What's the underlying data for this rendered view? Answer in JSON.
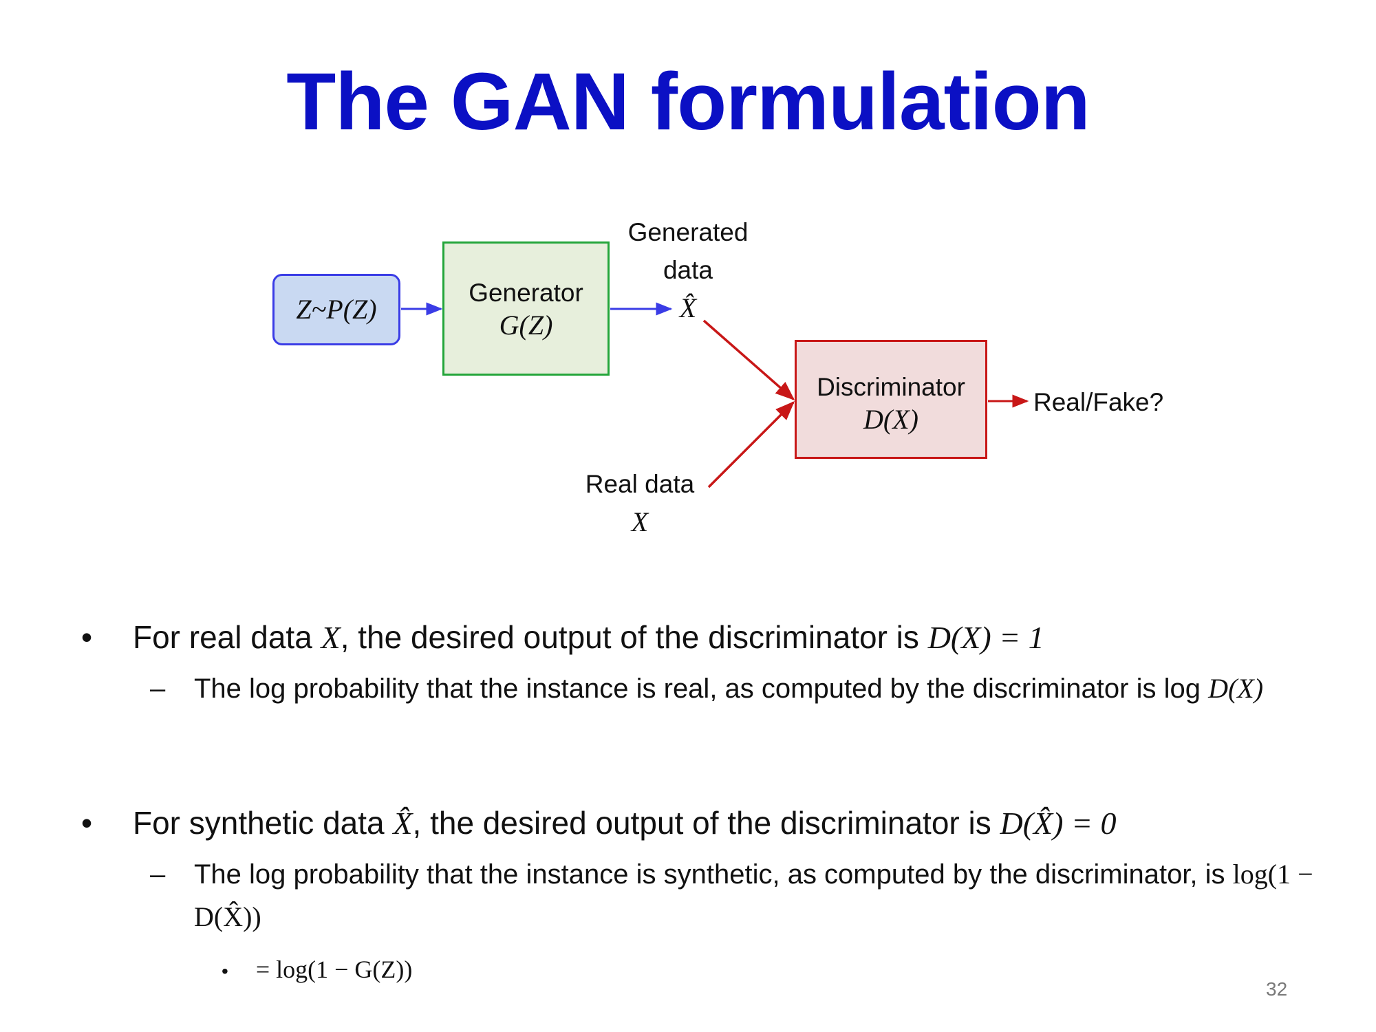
{
  "slide": {
    "title": "The GAN formulation",
    "page_number": "32"
  },
  "diagram": {
    "noise_box": {
      "math": "Z~P(Z)"
    },
    "generator_box": {
      "label": "Generator",
      "math": "G(Z)"
    },
    "generated_label": {
      "line1": "Generated",
      "line2": "data",
      "math": "X̂"
    },
    "real_label": {
      "line1": "Real data",
      "math": "X"
    },
    "discriminator_box": {
      "label": "Discriminator",
      "math": "D(X)"
    },
    "output_label": "Real/Fake?",
    "colors": {
      "blue": "#3a3ce6",
      "green": "#23a53a",
      "red": "#c81717",
      "title": "#0b10c4"
    }
  },
  "bullets": [
    {
      "pre": "For real data ",
      "var": "X",
      "mid": ", the desired output of the discriminator is ",
      "eq": "D(X) = 1",
      "sub": {
        "text": "The log probability that the instance is real, as computed by the discriminator is log ",
        "math": "D(X)"
      }
    },
    {
      "pre": "For synthetic data ",
      "var": "X̂",
      "mid": ", the desired output of the discriminator is ",
      "eq": "D(X̂) = 0",
      "sub": {
        "text": "The log probability that the instance is synthetic, as computed by the discriminator, is ",
        "math": "log(1 − D(X̂))"
      },
      "subsub": "= log(1 − G(Z))"
    }
  ]
}
